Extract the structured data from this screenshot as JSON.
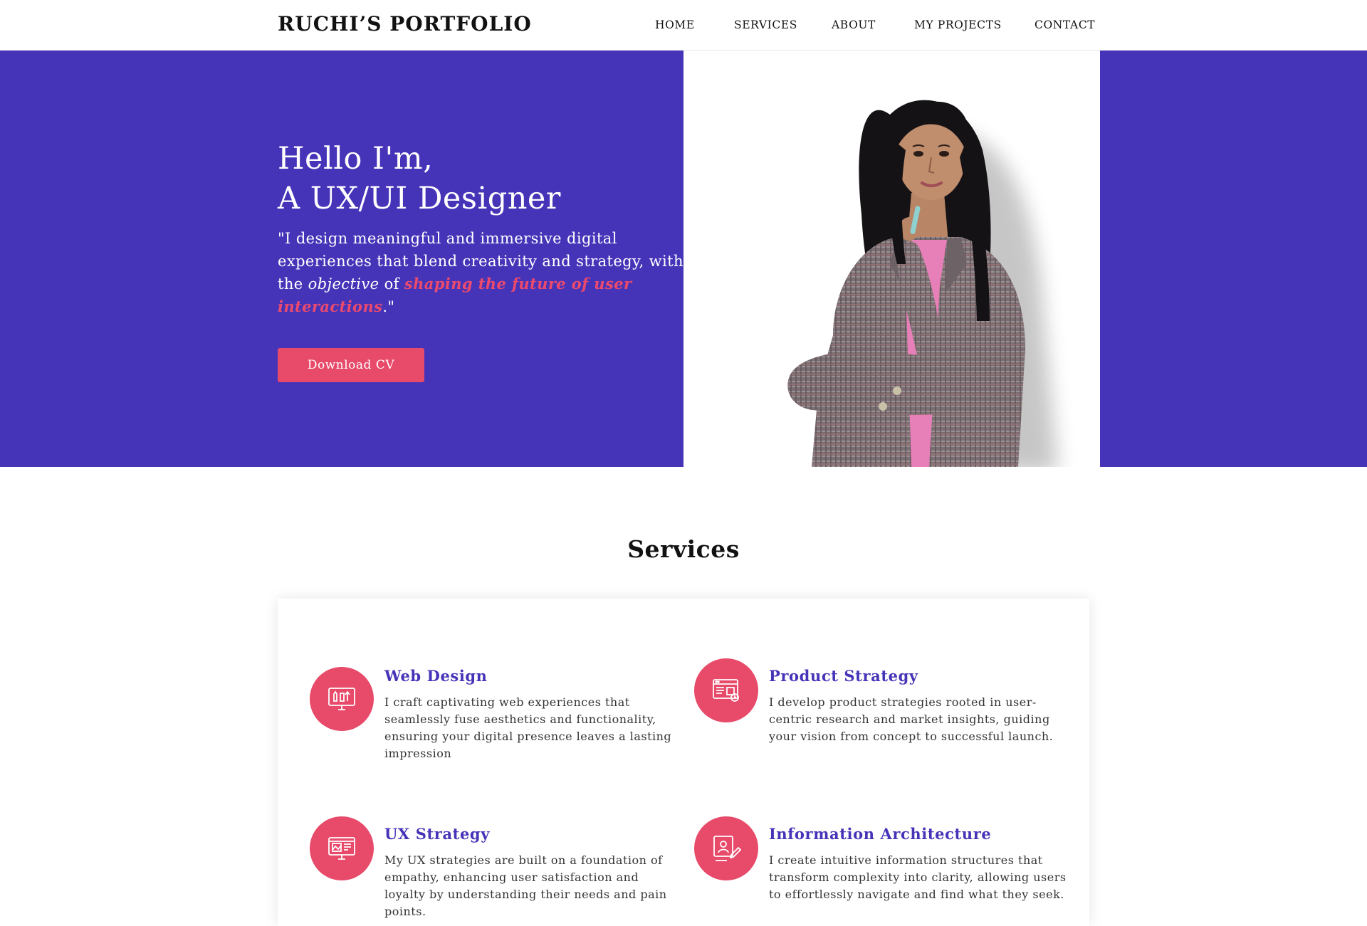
{
  "nav": {
    "brand": "RUCHI’S PORTFOLIO",
    "items": [
      "HOME",
      "SERVICES",
      "ABOUT",
      "MY PROJECTS",
      "CONTACT"
    ]
  },
  "hero": {
    "greeting": "Hello I'm,",
    "role": "A UX/UI Designer",
    "quote_open": "\"I design meaningful and immersive digital experiences that blend creativity and strategy, with the ",
    "quote_em": "objective",
    "quote_of": " of ",
    "quote_accent": "shaping the future of user interactions",
    "quote_close": ".\"",
    "cta": "Download CV"
  },
  "services": {
    "heading": "Services",
    "items": [
      {
        "title": "Web Design",
        "desc": "I craft captivating web experiences that seamlessly fuse aesthetics and functionality, ensuring your digital presence leaves a lasting impression",
        "icon": "web-design-icon"
      },
      {
        "title": "Product Strategy",
        "desc": "I develop product strategies rooted in user-centric research and market insights, guiding your vision from concept to successful launch.",
        "icon": "product-strategy-icon"
      },
      {
        "title": "UX Strategy",
        "desc": "My UX strategies are built on a foundation of empathy, enhancing user satisfaction and loyalty by understanding their needs and pain points.",
        "icon": "ux-strategy-icon"
      },
      {
        "title": "Information Architecture",
        "desc": "I create intuitive information structures that transform complexity into clarity, allowing users to effortlessly navigate and find what they seek.",
        "icon": "information-architecture-icon"
      }
    ]
  },
  "colors": {
    "hero_bg": "#4634b8",
    "accent": "#e84a6a",
    "heading_purple": "#4634b8"
  }
}
